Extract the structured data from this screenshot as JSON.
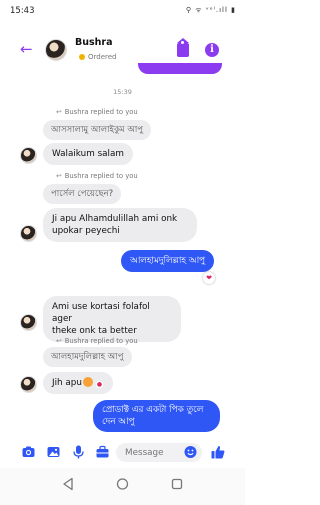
{
  "status_bar": {
    "time": "15:43",
    "indicators": "⚲ ᯤ ᵛᵒˡ.ıll ▮"
  },
  "header": {
    "back_icon": "back-arrow-icon",
    "contact_name": "Bushra",
    "contact_status": "Ordered",
    "status_color": "#f0b400",
    "accent_color": "#8b3cf0"
  },
  "thread": {
    "timestamp": "15:39",
    "messages": [
      {
        "reply_note": "Bushra replied to you",
        "quoted": "আসসালামু আলাইকুম আপু",
        "text": "Walaikum salam"
      },
      {
        "reply_note": "Bushra replied to you",
        "quoted": "পার্সেল পেয়েছেন?",
        "text_line1": "Ji apu Alhamdulillah ami onk",
        "text_line2": "upokar peyechi"
      },
      {
        "outgoing": "আলহামদুলিল্লাহ আপু",
        "reaction": "❤"
      },
      {
        "text_line1": "Ami use kortasi folafol ager",
        "text_line2": "theke onk ta better"
      },
      {
        "reply_note": "Bushra replied to you",
        "quoted": "আলহামদুলিল্লাহ আপু",
        "text": "Jih apu"
      },
      {
        "outgoing_line1": "প্রোডাক্ট এর একটা পিক তুলে",
        "outgoing_line2": "দেন আপু"
      }
    ]
  },
  "composer": {
    "placeholder": "Message",
    "icons": [
      "camera-icon",
      "gallery-icon",
      "microphone-icon",
      "briefcase-icon",
      "emoji-icon",
      "thumbs-up-icon"
    ],
    "accent_color": "#2f57f5"
  },
  "navbar": {
    "icons": [
      "nav-back-icon",
      "nav-home-icon",
      "nav-recents-icon"
    ]
  }
}
